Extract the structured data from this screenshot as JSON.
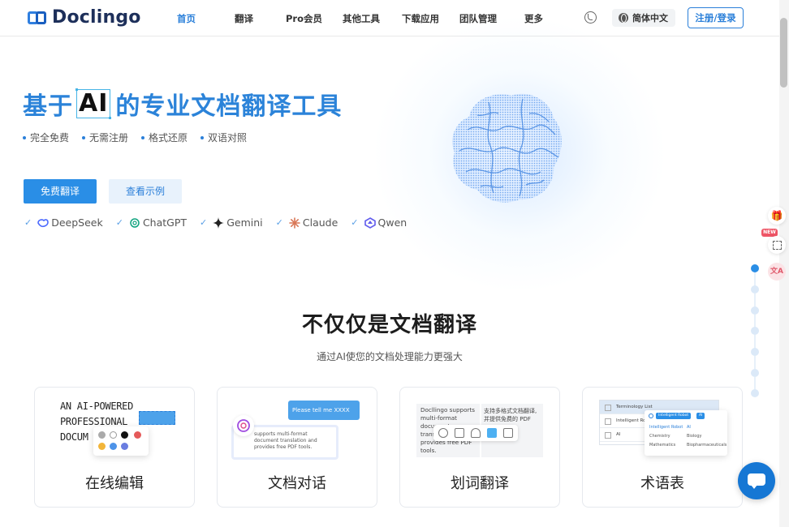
{
  "header": {
    "logo_text": "Doclingo",
    "nav": [
      {
        "label": "首页"
      },
      {
        "label": "翻译"
      },
      {
        "label": "Pro会员"
      },
      {
        "label": "其他工具"
      },
      {
        "label": "下载应用"
      },
      {
        "label": "团队管理"
      },
      {
        "label": "更多"
      }
    ],
    "language": "简体中文",
    "login": "注册/登录"
  },
  "hero": {
    "title_before": "基于",
    "title_ai": "AI",
    "title_after": "的专业文档翻译工具",
    "features": [
      "完全免费",
      "无需注册",
      "格式还原",
      "双语对照"
    ],
    "primary_button": "免费翻译",
    "secondary_button": "查看示例",
    "models": [
      "DeepSeek",
      "ChatGPT",
      "Gemini",
      "Claude",
      "Qwen"
    ]
  },
  "side": {
    "new_badge": "NEW"
  },
  "section": {
    "title": "不仅仅是文档翻译",
    "subtitle": "通过AI使您的文档处理能力更强大"
  },
  "cards": [
    {
      "label": "在线编辑",
      "preview_lines": [
        "AN AI-POWERED",
        "PROFESSIONAL",
        "DOCUM"
      ]
    },
    {
      "label": "文档对话",
      "bubble": "Please tell me XXXX",
      "preview": "supports multi-format document translation and provides free PDF tools."
    },
    {
      "label": "划词翻译",
      "preview_left": "Docllingo supports multi-format document translation and provides free PDF tools.",
      "preview_right": "支持多格式文档翻译, 并提供免费的 PDF"
    },
    {
      "label": "术语表",
      "rows": [
        "Terminology List",
        "Intelligent Robot",
        "AI"
      ],
      "tags": [
        "Intelligent Robot",
        "AI"
      ],
      "terms": [
        "Intelligent Robot",
        "AI",
        "Chemistry",
        "Biology",
        "Mathematics",
        "Biopharmaceuticals"
      ]
    }
  ],
  "colors": {
    "brand": "#2a7fd9",
    "primary_button": "#2a8ee6",
    "chat_button": "#1677d4"
  }
}
